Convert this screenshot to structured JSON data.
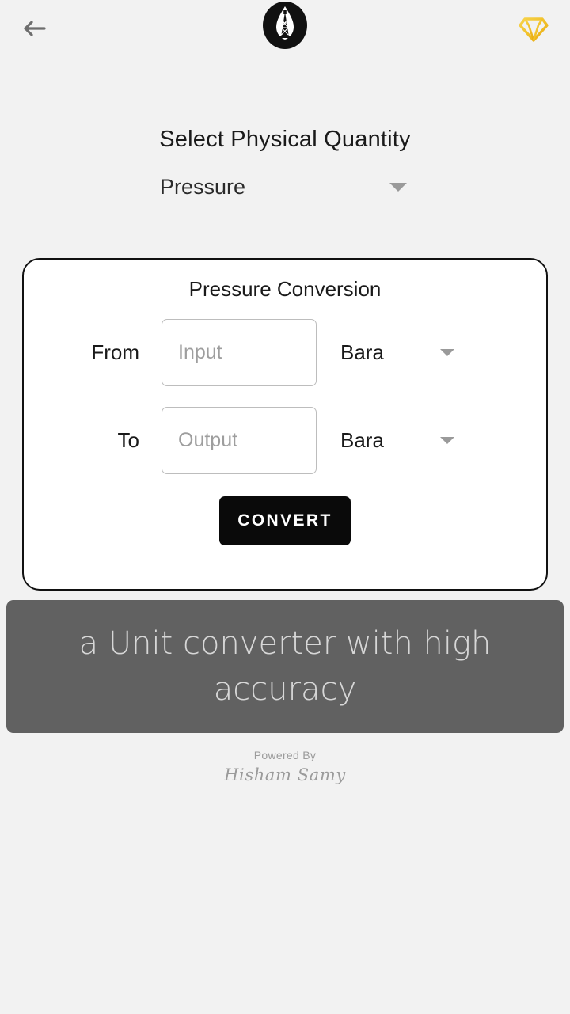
{
  "appbar": {
    "back_icon": "arrow-left-icon",
    "logo_icon": "oil-derrick-logo",
    "premium_icon": "diamond-gem-icon",
    "back_label": "Back",
    "premium_label": "Premium"
  },
  "quantity": {
    "title": "Select Physical Quantity",
    "selected": "Pressure",
    "caret_icon": "chevron-down-icon"
  },
  "card": {
    "title": "Pressure Conversion",
    "from": {
      "label": "From",
      "value": "",
      "placeholder": "Input",
      "unit": "Bara"
    },
    "to": {
      "label": "To",
      "value": "",
      "placeholder": "Output",
      "unit": "Bara"
    },
    "convert_label": "CONVERT"
  },
  "banner": {
    "text": "a Unit converter with high accuracy"
  },
  "footer": {
    "powered_by": "Powered By",
    "author": "Hisham Samy"
  },
  "colors": {
    "background": "#f2f2f2",
    "card_border": "#111111",
    "card_background": "#ffffff",
    "convert_button": "#0a0a0a",
    "banner": "#616161",
    "banner_text": "#d7d7d7",
    "premium_gold": "#f2c230",
    "muted_text": "#9b9b9b"
  }
}
